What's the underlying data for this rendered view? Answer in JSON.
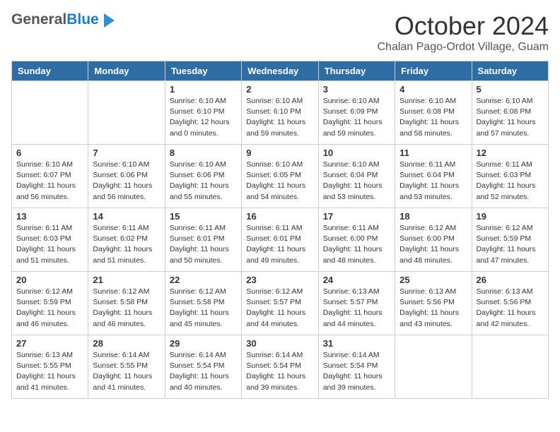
{
  "header": {
    "logo_general": "General",
    "logo_blue": "Blue",
    "month_title": "October 2024",
    "location": "Chalan Pago-Ordot Village, Guam"
  },
  "days_of_week": [
    "Sunday",
    "Monday",
    "Tuesday",
    "Wednesday",
    "Thursday",
    "Friday",
    "Saturday"
  ],
  "weeks": [
    [
      {
        "day": "",
        "sunrise": "",
        "sunset": "",
        "daylight": ""
      },
      {
        "day": "",
        "sunrise": "",
        "sunset": "",
        "daylight": ""
      },
      {
        "day": "1",
        "sunrise": "Sunrise: 6:10 AM",
        "sunset": "Sunset: 6:10 PM",
        "daylight": "Daylight: 12 hours and 0 minutes."
      },
      {
        "day": "2",
        "sunrise": "Sunrise: 6:10 AM",
        "sunset": "Sunset: 6:10 PM",
        "daylight": "Daylight: 11 hours and 59 minutes."
      },
      {
        "day": "3",
        "sunrise": "Sunrise: 6:10 AM",
        "sunset": "Sunset: 6:09 PM",
        "daylight": "Daylight: 11 hours and 59 minutes."
      },
      {
        "day": "4",
        "sunrise": "Sunrise: 6:10 AM",
        "sunset": "Sunset: 6:08 PM",
        "daylight": "Daylight: 11 hours and 58 minutes."
      },
      {
        "day": "5",
        "sunrise": "Sunrise: 6:10 AM",
        "sunset": "Sunset: 6:08 PM",
        "daylight": "Daylight: 11 hours and 57 minutes."
      }
    ],
    [
      {
        "day": "6",
        "sunrise": "Sunrise: 6:10 AM",
        "sunset": "Sunset: 6:07 PM",
        "daylight": "Daylight: 11 hours and 56 minutes."
      },
      {
        "day": "7",
        "sunrise": "Sunrise: 6:10 AM",
        "sunset": "Sunset: 6:06 PM",
        "daylight": "Daylight: 11 hours and 56 minutes."
      },
      {
        "day": "8",
        "sunrise": "Sunrise: 6:10 AM",
        "sunset": "Sunset: 6:06 PM",
        "daylight": "Daylight: 11 hours and 55 minutes."
      },
      {
        "day": "9",
        "sunrise": "Sunrise: 6:10 AM",
        "sunset": "Sunset: 6:05 PM",
        "daylight": "Daylight: 11 hours and 54 minutes."
      },
      {
        "day": "10",
        "sunrise": "Sunrise: 6:10 AM",
        "sunset": "Sunset: 6:04 PM",
        "daylight": "Daylight: 11 hours and 53 minutes."
      },
      {
        "day": "11",
        "sunrise": "Sunrise: 6:11 AM",
        "sunset": "Sunset: 6:04 PM",
        "daylight": "Daylight: 11 hours and 53 minutes."
      },
      {
        "day": "12",
        "sunrise": "Sunrise: 6:11 AM",
        "sunset": "Sunset: 6:03 PM",
        "daylight": "Daylight: 11 hours and 52 minutes."
      }
    ],
    [
      {
        "day": "13",
        "sunrise": "Sunrise: 6:11 AM",
        "sunset": "Sunset: 6:03 PM",
        "daylight": "Daylight: 11 hours and 51 minutes."
      },
      {
        "day": "14",
        "sunrise": "Sunrise: 6:11 AM",
        "sunset": "Sunset: 6:02 PM",
        "daylight": "Daylight: 11 hours and 51 minutes."
      },
      {
        "day": "15",
        "sunrise": "Sunrise: 6:11 AM",
        "sunset": "Sunset: 6:01 PM",
        "daylight": "Daylight: 11 hours and 50 minutes."
      },
      {
        "day": "16",
        "sunrise": "Sunrise: 6:11 AM",
        "sunset": "Sunset: 6:01 PM",
        "daylight": "Daylight: 11 hours and 49 minutes."
      },
      {
        "day": "17",
        "sunrise": "Sunrise: 6:11 AM",
        "sunset": "Sunset: 6:00 PM",
        "daylight": "Daylight: 11 hours and 48 minutes."
      },
      {
        "day": "18",
        "sunrise": "Sunrise: 6:12 AM",
        "sunset": "Sunset: 6:00 PM",
        "daylight": "Daylight: 11 hours and 48 minutes."
      },
      {
        "day": "19",
        "sunrise": "Sunrise: 6:12 AM",
        "sunset": "Sunset: 5:59 PM",
        "daylight": "Daylight: 11 hours and 47 minutes."
      }
    ],
    [
      {
        "day": "20",
        "sunrise": "Sunrise: 6:12 AM",
        "sunset": "Sunset: 5:59 PM",
        "daylight": "Daylight: 11 hours and 46 minutes."
      },
      {
        "day": "21",
        "sunrise": "Sunrise: 6:12 AM",
        "sunset": "Sunset: 5:58 PM",
        "daylight": "Daylight: 11 hours and 46 minutes."
      },
      {
        "day": "22",
        "sunrise": "Sunrise: 6:12 AM",
        "sunset": "Sunset: 5:58 PM",
        "daylight": "Daylight: 11 hours and 45 minutes."
      },
      {
        "day": "23",
        "sunrise": "Sunrise: 6:12 AM",
        "sunset": "Sunset: 5:57 PM",
        "daylight": "Daylight: 11 hours and 44 minutes."
      },
      {
        "day": "24",
        "sunrise": "Sunrise: 6:13 AM",
        "sunset": "Sunset: 5:57 PM",
        "daylight": "Daylight: 11 hours and 44 minutes."
      },
      {
        "day": "25",
        "sunrise": "Sunrise: 6:13 AM",
        "sunset": "Sunset: 5:56 PM",
        "daylight": "Daylight: 11 hours and 43 minutes."
      },
      {
        "day": "26",
        "sunrise": "Sunrise: 6:13 AM",
        "sunset": "Sunset: 5:56 PM",
        "daylight": "Daylight: 11 hours and 42 minutes."
      }
    ],
    [
      {
        "day": "27",
        "sunrise": "Sunrise: 6:13 AM",
        "sunset": "Sunset: 5:55 PM",
        "daylight": "Daylight: 11 hours and 41 minutes."
      },
      {
        "day": "28",
        "sunrise": "Sunrise: 6:14 AM",
        "sunset": "Sunset: 5:55 PM",
        "daylight": "Daylight: 11 hours and 41 minutes."
      },
      {
        "day": "29",
        "sunrise": "Sunrise: 6:14 AM",
        "sunset": "Sunset: 5:54 PM",
        "daylight": "Daylight: 11 hours and 40 minutes."
      },
      {
        "day": "30",
        "sunrise": "Sunrise: 6:14 AM",
        "sunset": "Sunset: 5:54 PM",
        "daylight": "Daylight: 11 hours and 39 minutes."
      },
      {
        "day": "31",
        "sunrise": "Sunrise: 6:14 AM",
        "sunset": "Sunset: 5:54 PM",
        "daylight": "Daylight: 11 hours and 39 minutes."
      },
      {
        "day": "",
        "sunrise": "",
        "sunset": "",
        "daylight": ""
      },
      {
        "day": "",
        "sunrise": "",
        "sunset": "",
        "daylight": ""
      }
    ]
  ]
}
